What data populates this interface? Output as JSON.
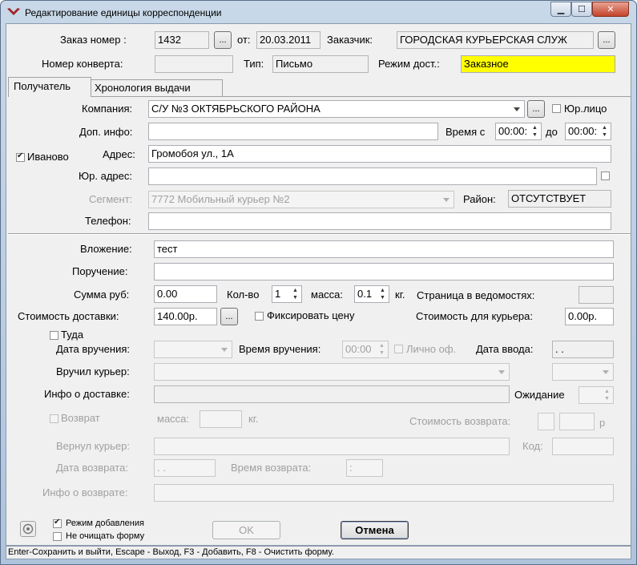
{
  "window": {
    "title": "Редактирование единицы корреспонденции",
    "minimize": "▁",
    "maximize": "☐",
    "close": "✕"
  },
  "header": {
    "order_label": "Заказ номер :",
    "order_value": "1432",
    "browse": "...",
    "from_label": "от:",
    "from_value": "20.03.2011",
    "customer_label": "Заказчик:",
    "customer_value": "ГОРОДСКАЯ КУРЬЕРСКАЯ СЛУЖ",
    "envelope_label": "Номер конверта:",
    "envelope_value": "",
    "type_label": "Тип:",
    "type_value": "Письмо",
    "mode_label": "Режим дост.:",
    "mode_value": "Заказное",
    "mode_color": "#ffff00"
  },
  "tabs": [
    {
      "label": "Получатель"
    },
    {
      "label": "Хронология выдачи"
    }
  ],
  "recipient": {
    "company_label": "Компания:",
    "company_value": "С/У №3 ОКТЯБРЬСКОГО РАЙОНА",
    "legal_label": "Юр.лицо",
    "extra_label": "Доп. инфо:",
    "extra_value": "",
    "time_from_label": "Время с",
    "time_from": "00:00:",
    "time_to_label": "до",
    "time_to": "00:00:",
    "city_label": "Иваново",
    "address_label": "Адрес:",
    "address_value": "Громобоя ул., 1А",
    "legal_address_label": "Юр. адрес:",
    "legal_address_value": "",
    "segment_label": "Сегмент:",
    "segment_value": "7772 Мобильный курьер №2",
    "district_label": "Район:",
    "district_value": "ОТСУТСТВУЕТ",
    "phone_label": "Телефон:",
    "phone_value": ""
  },
  "details": {
    "attachment_label": "Вложение:",
    "attachment_value": "тест",
    "order_note_label": "Поручение:",
    "order_note_value": "",
    "sum_label": "Сумма руб:",
    "sum_value": "0.00",
    "qty_label": "Кол-во",
    "qty_value": "1",
    "mass_label": "масса:",
    "mass_value": "0.1",
    "kg": "кг.",
    "page_label": "Страница в ведомостях:",
    "page_value": "",
    "cost_label": "Стоимость доставки:",
    "cost_value": "140.00р.",
    "fix_label": "Фиксировать цену",
    "courier_cost_label": "Стоимость для курьера:",
    "courier_cost_value": "0.00р."
  },
  "delivery": {
    "there_label": "Туда",
    "date_label": "Дата вручения:",
    "time_label": "Время вручения:",
    "time_value": "00:00",
    "personal_label": "Лично оф.",
    "entry_date_label": "Дата ввода:",
    "entry_date_value": " .  .",
    "courier_label": "Вручил курьер:",
    "info_label": "Инфо о доставке:",
    "wait_label": "Ожидание"
  },
  "returns": {
    "return_label": "Возврат",
    "mass_label": "масса:",
    "kg": "кг.",
    "cost_label": "Стоимость возврата:",
    "rub": "р",
    "courier_label": "Вернул курьер:",
    "code_label": "Код:",
    "date_label": "Дата возврата:",
    "date_value": " .  .",
    "time_label": "Время возврата:",
    "time_value": " :",
    "info_label": "Инфо о возврате:"
  },
  "footer": {
    "add_mode_label": "Режим добавления",
    "no_clear_label": "Не очищать форму",
    "ok_label": "OK",
    "cancel_label": "Отмена"
  },
  "status": {
    "text": "Enter-Сохранить и выйти, Escape - Выход, F3 - Добавить, F8 - Очистить форму."
  }
}
